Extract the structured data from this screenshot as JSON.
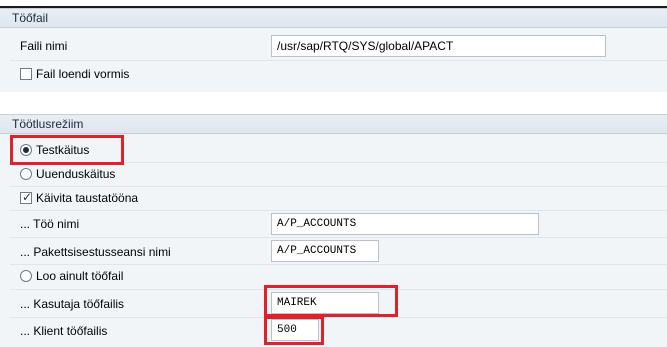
{
  "sections": {
    "file": {
      "title": "Töőfail"
    },
    "processing": {
      "title": "Töötlusrežiim"
    }
  },
  "file": {
    "name_label": "Faili nimi",
    "name_value": "/usr/sap/RTQ/SYS/global/APACT",
    "list_format_label": "Fail loendi vormis",
    "list_format_checked": false
  },
  "processing": {
    "test_run_label": "Testkäitus",
    "test_run_selected": true,
    "update_run_label": "Uuenduskäitus",
    "update_run_selected": false,
    "background_label": "Käivita taustatööna",
    "background_checked": true,
    "job_name_label": "... Töö nimi",
    "job_name_value": "A/P_ACCOUNTS",
    "batch_session_label": "... Pakettsisestusseansi nimi",
    "batch_session_value": "A/P_ACCOUNTS",
    "create_file_only_label": "Loo ainult töőfail",
    "create_file_only_selected": false,
    "user_label": "... Kasutaja töőfailis",
    "user_value": "MAIREK",
    "client_label": "... Klient töőfailis",
    "client_value": "500"
  },
  "colors": {
    "highlight": "#e0202a",
    "section_bg": "#e9eef4",
    "panel_bg": "#f2f5f8"
  }
}
